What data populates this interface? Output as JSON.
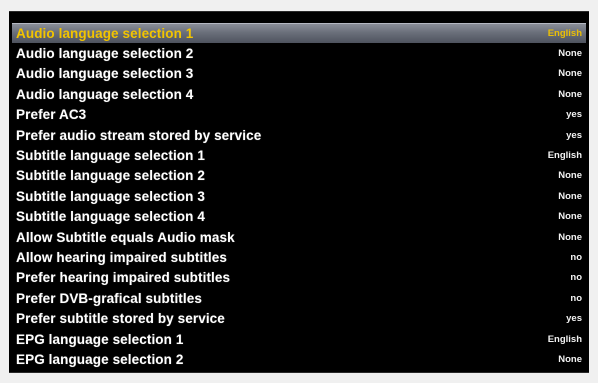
{
  "settings": [
    {
      "label": "Audio language selection 1",
      "value": "English",
      "selected": true
    },
    {
      "label": "Audio language selection 2",
      "value": "None"
    },
    {
      "label": "Audio language selection 3",
      "value": "None"
    },
    {
      "label": "Audio language selection 4",
      "value": "None"
    },
    {
      "label": "Prefer AC3",
      "value": "yes"
    },
    {
      "label": "Prefer audio stream stored by service",
      "value": "yes"
    },
    {
      "label": "Subtitle language selection 1",
      "value": "English"
    },
    {
      "label": "Subtitle language selection 2",
      "value": "None"
    },
    {
      "label": "Subtitle language selection 3",
      "value": "None"
    },
    {
      "label": "Subtitle language selection 4",
      "value": "None"
    },
    {
      "label": "Allow Subtitle equals Audio mask",
      "value": "None"
    },
    {
      "label": "Allow hearing impaired subtitles",
      "value": "no"
    },
    {
      "label": "Prefer hearing impaired subtitles",
      "value": "no"
    },
    {
      "label": "Prefer DVB-grafical subtitles",
      "value": "no"
    },
    {
      "label": "Prefer subtitle stored by service",
      "value": "yes"
    },
    {
      "label": "EPG language selection 1",
      "value": "English"
    },
    {
      "label": "EPG language selection 2",
      "value": "None"
    }
  ],
  "colors": {
    "background": "#000000",
    "text": "#ffffff",
    "highlight_text": "#f2c400",
    "highlight_bar": "#6a6f7a"
  }
}
